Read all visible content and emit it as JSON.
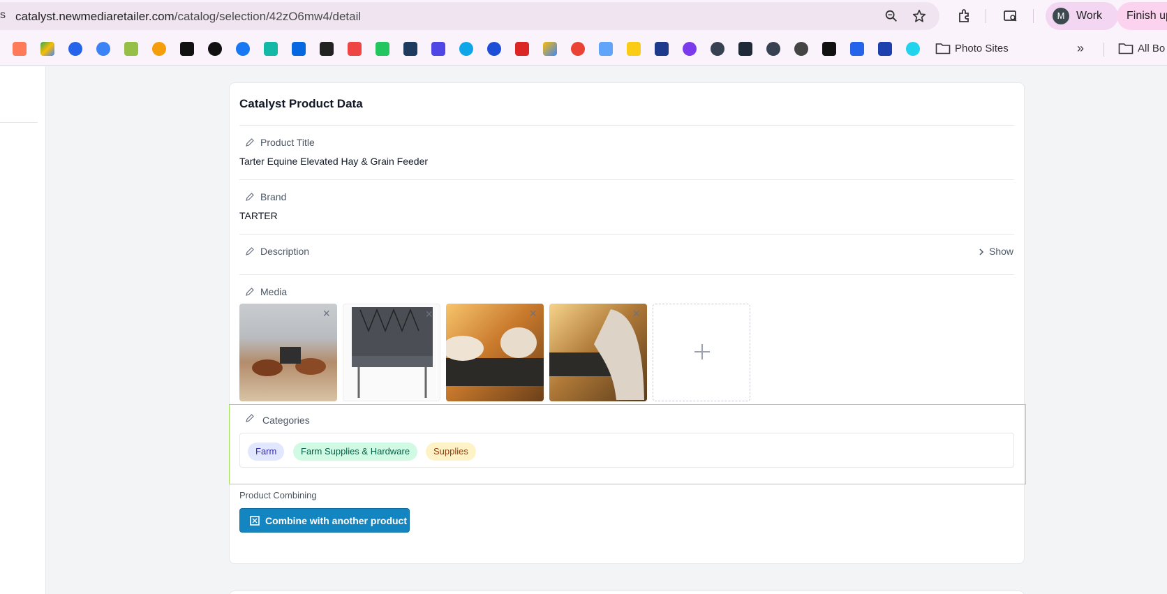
{
  "browser": {
    "url_host": "catalyst.newmediaretailer.com",
    "url_path": "/catalog/selection/42zO6mw4/detail",
    "profile_initial": "M",
    "profile_name": "Work",
    "finish_label": "Finish up",
    "bookmark_folders": [
      "Photo Sites",
      "All Bo"
    ]
  },
  "card": {
    "title": "Catalyst Product Data",
    "fields": {
      "product_title_label": "Product Title",
      "product_title_value": "Tarter Equine Elevated Hay & Grain Feeder",
      "brand_label": "Brand",
      "brand_value": "TARTER",
      "description_label": "Description",
      "description_toggle": "Show",
      "media_label": "Media",
      "categories_label": "Categories"
    },
    "media_count": 4,
    "categories": [
      {
        "label": "Farm",
        "bg": "#e0e7ff",
        "fg": "#3730a3"
      },
      {
        "label": "Farm Supplies & Hardware",
        "bg": "#d1fae5",
        "fg": "#065f46"
      },
      {
        "label": "Supplies",
        "bg": "#fef3c7",
        "fg": "#92400e"
      }
    ],
    "combining": {
      "label": "Product Combining",
      "button": "Combine with another product"
    }
  },
  "colors": {
    "accent": "#1386c2",
    "highlight_border": "#a3e05c"
  }
}
